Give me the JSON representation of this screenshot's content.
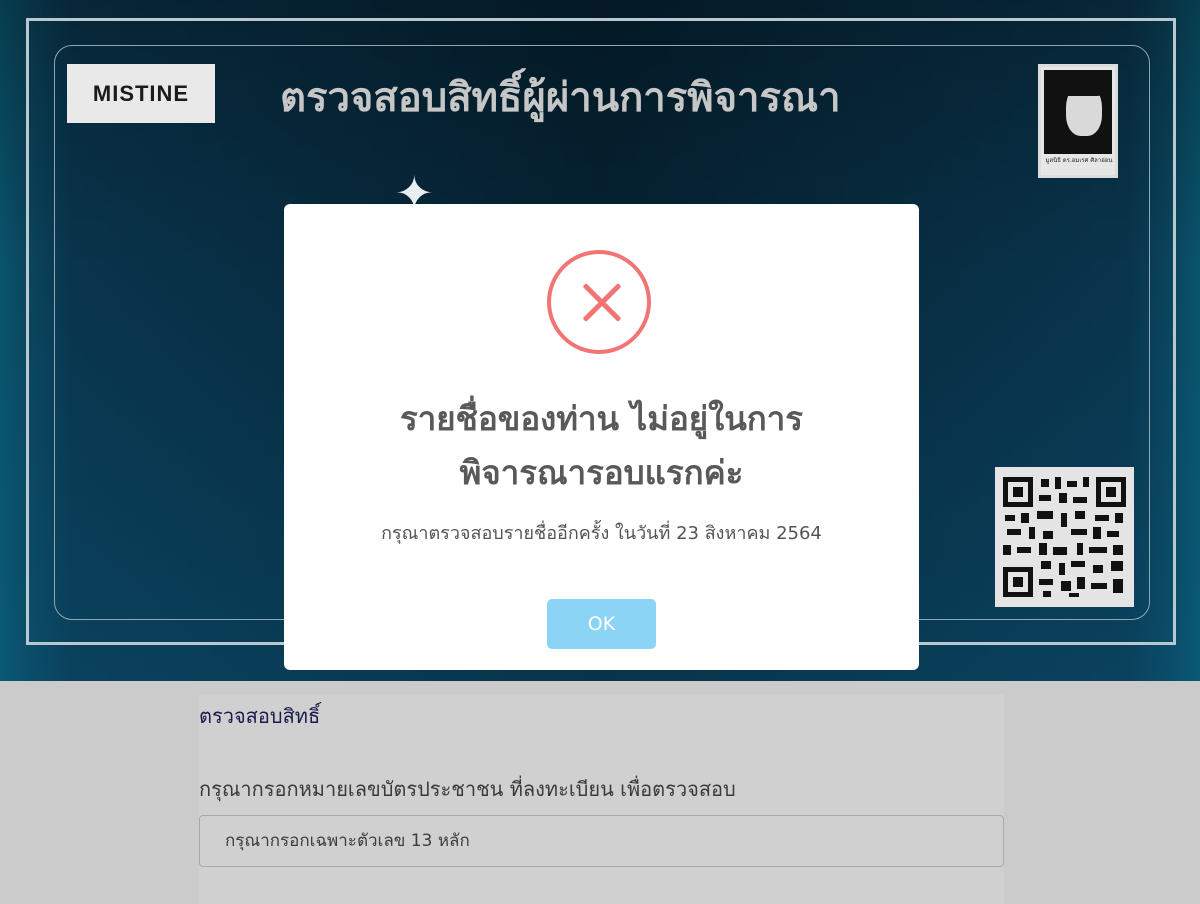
{
  "banner": {
    "brand_logo": "MISTINE",
    "title": "ตรวจสอบสิทธิ์ผู้ผ่านการพิจารณา",
    "sparkle": "✦",
    "portrait_caption": "มูลนิธิ ดร.อมเรศ ศิลาอ่อน"
  },
  "form": {
    "section_title": "ตรวจสอบสิทธิ์",
    "label": "กรุณากรอกหมายเลขบัตรประชาชน ที่ลงทะเบียน เพื่อตรวจสอบ",
    "id_placeholder": "กรุณากรอกเฉพาะตัวเลข 13 หลัก",
    "id_value": ""
  },
  "modal": {
    "icon": "error-x-icon",
    "title_line1": "รายชื่อของท่าน ไม่อยู่ในการ",
    "title_line2": "พิจารณารอบแรกค่ะ",
    "message": "กรุณาตรวจสอบรายชื่ออีกครั้ง ในวันที่ 23 สิงหาคม 2564",
    "ok_label": "OK"
  },
  "colors": {
    "error": "#f27474",
    "ok_button": "#8cd4f5",
    "banner_dark": "#062638"
  }
}
